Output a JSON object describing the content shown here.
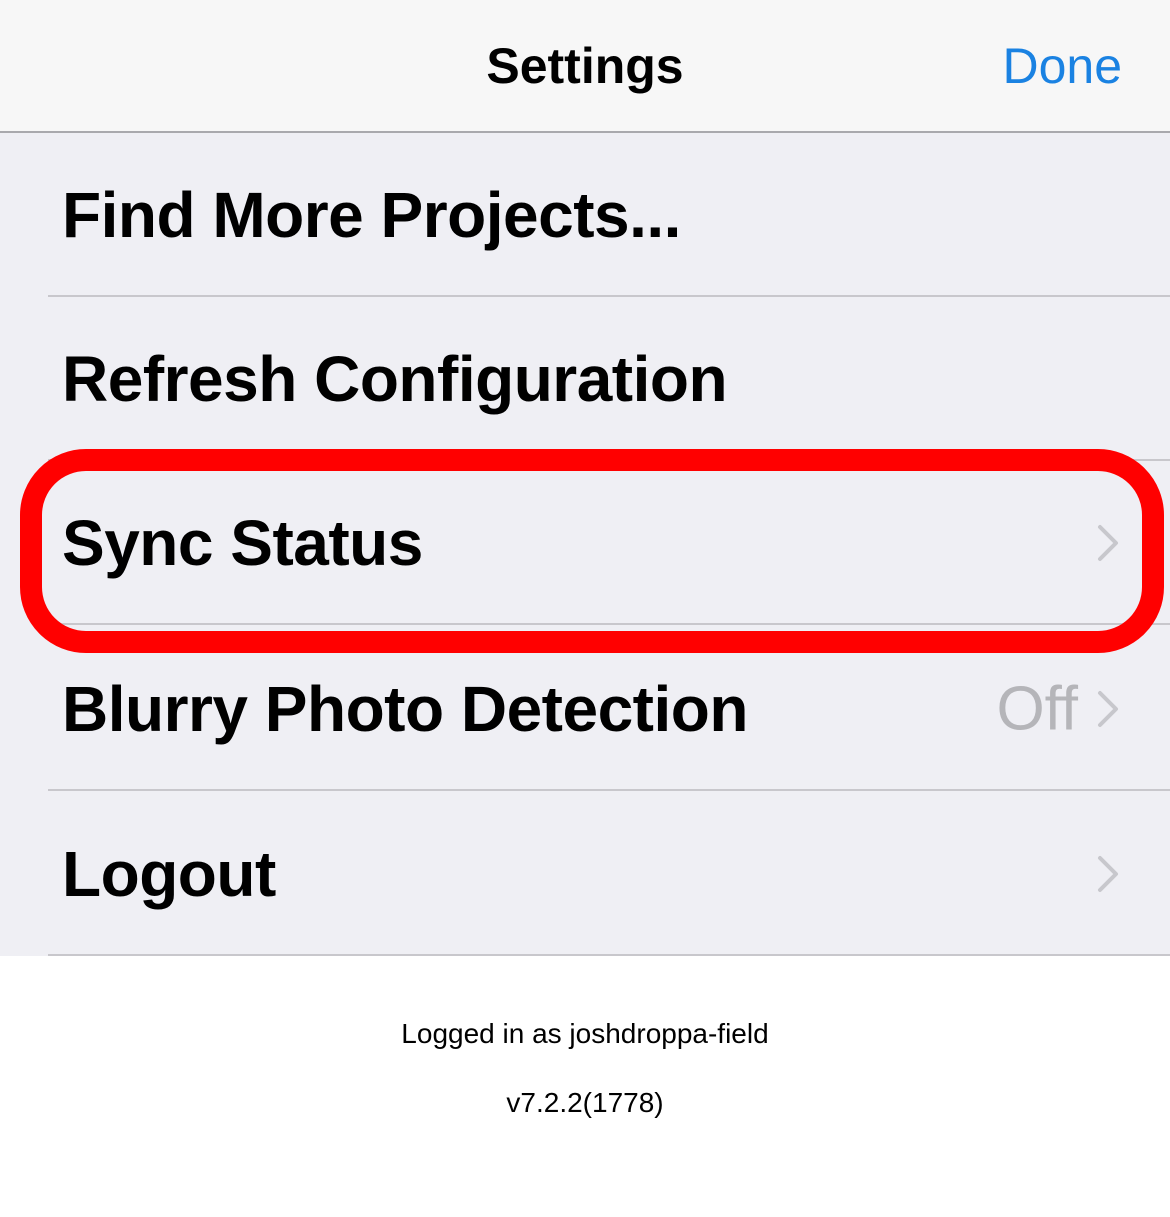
{
  "nav": {
    "title": "Settings",
    "done_label": "Done"
  },
  "settings": {
    "items": [
      {
        "label": "Find More Projects..."
      },
      {
        "label": "Refresh Configuration"
      },
      {
        "label": "Sync Status"
      },
      {
        "label": "Blurry Photo Detection",
        "value": "Off"
      },
      {
        "label": "Logout"
      }
    ]
  },
  "footer": {
    "logged_in": "Logged in as joshdroppa-field",
    "version": "v7.2.2(1778)"
  },
  "colors": {
    "accent": "#1a82e2",
    "list_background": "#efeff4",
    "highlight": "#ff0000",
    "secondary_text": "#b5b5b9"
  },
  "icons": {
    "disclosure": "chevron-right-icon"
  }
}
